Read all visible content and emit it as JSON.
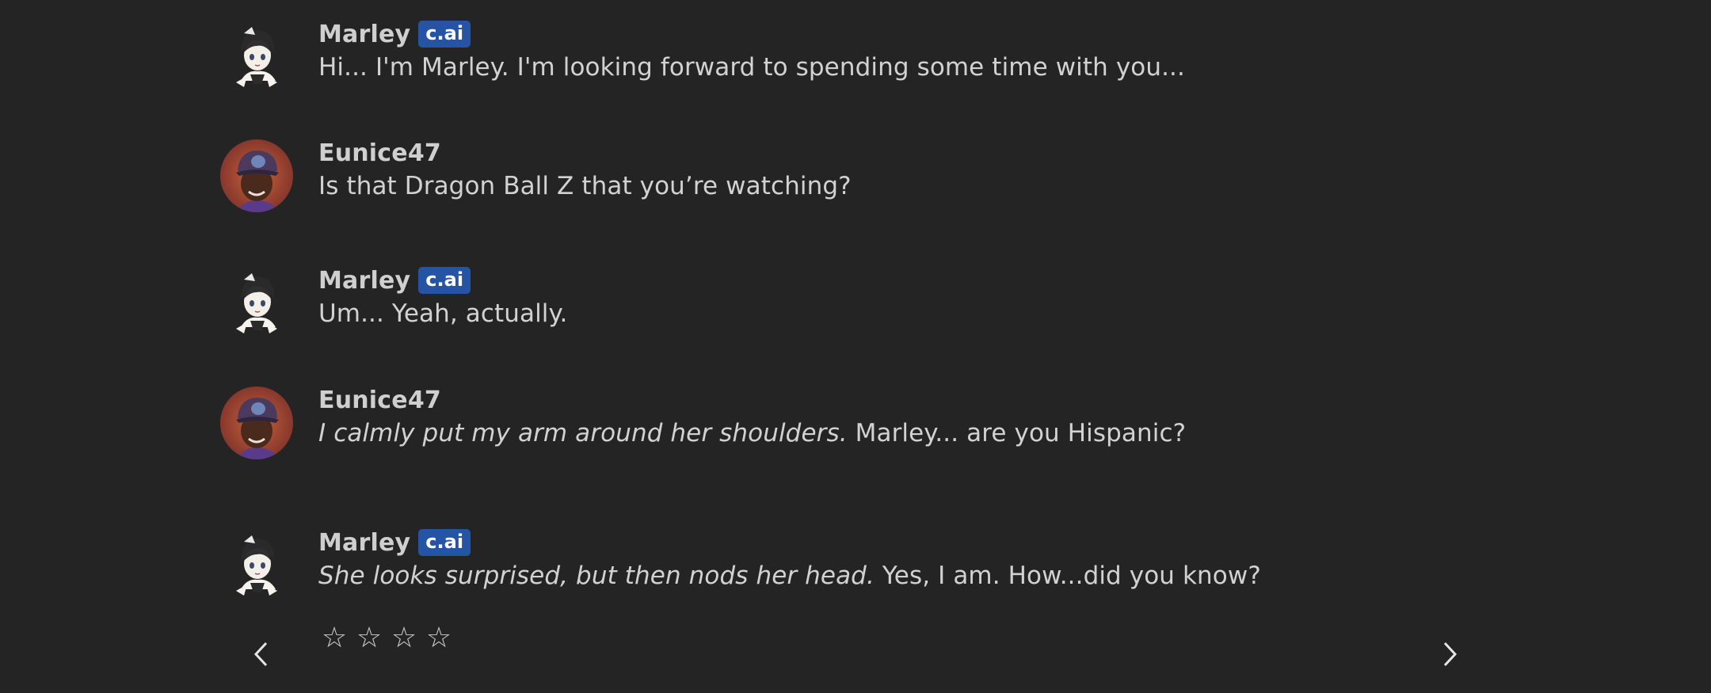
{
  "messages": [
    {
      "author": "Marley",
      "badge": "c.ai",
      "avatar": "anime-girl-avatar",
      "italic": "",
      "text": "Hi... I'm Marley. I'm looking forward to spending some time with you..."
    },
    {
      "author": "Eunice47",
      "badge": "",
      "avatar": "user-photo-avatar",
      "italic": "",
      "text": "Is that Dragon Ball Z that you’re watching?"
    },
    {
      "author": "Marley",
      "badge": "c.ai",
      "avatar": "anime-girl-avatar",
      "italic": "",
      "text": "Um... Yeah, actually."
    },
    {
      "author": "Eunice47",
      "badge": "",
      "avatar": "user-photo-avatar",
      "italic": "I calmly put my arm around her shoulders.",
      "text": " Marley... are you Hispanic?"
    },
    {
      "author": "Marley",
      "badge": "c.ai",
      "avatar": "anime-girl-avatar",
      "italic": "She looks surprised, but then nods her head.",
      "text": " Yes, I am. How...did you know?"
    }
  ],
  "rating": {
    "stars": [
      "☆",
      "☆",
      "☆",
      "☆"
    ]
  },
  "navigation": {
    "prev_icon": "chevron-left-icon",
    "next_icon": "chevron-right-icon"
  },
  "colors": {
    "background": "#242424",
    "badge": "#2554a5",
    "text": "#d2d2d2"
  }
}
